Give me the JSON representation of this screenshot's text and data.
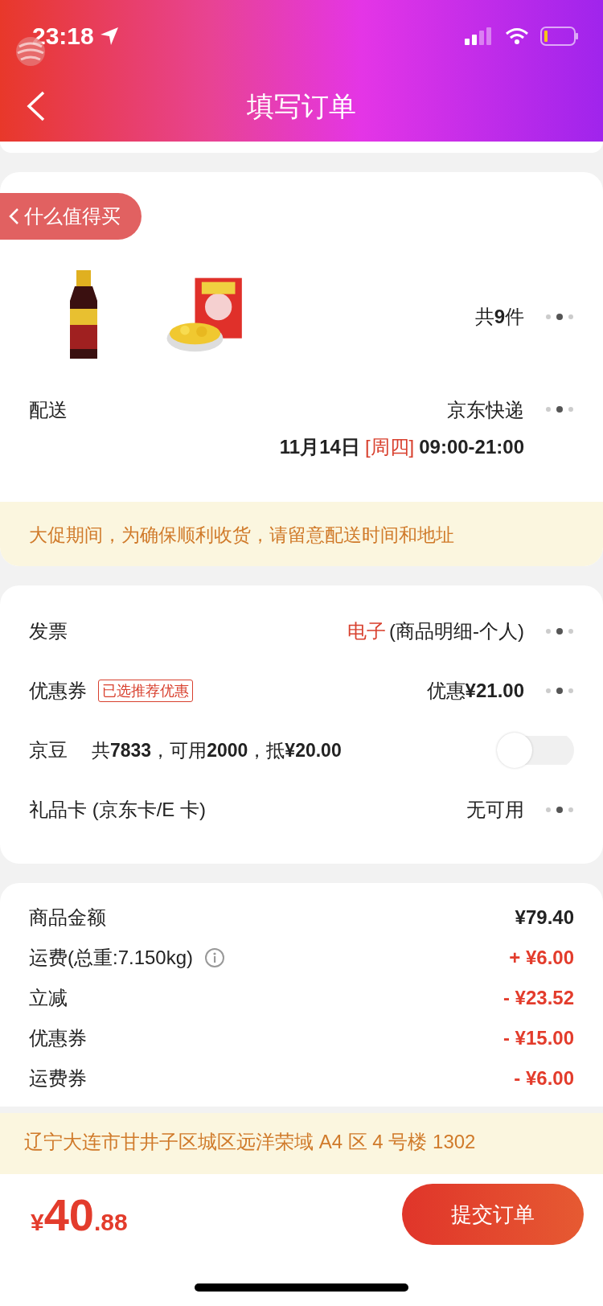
{
  "status_bar": {
    "time": "23:18"
  },
  "nav": {
    "title": "填写订单"
  },
  "float_badge": {
    "label": "什么值得买"
  },
  "products": {
    "count": "共**9**件"
  },
  "delivery": {
    "label": "配送",
    "carrier": "京东快递",
    "date": "11月14日",
    "weekday": "[周四]",
    "time": "09:00-21:00"
  },
  "notice": "大促期间，为确保顺利收货，请留意配送时间和地址",
  "options": [
    {
      "kind": "link",
      "label": "发票",
      "highlight": "电子",
      "value": "(商品明细-个人)"
    },
    {
      "kind": "link",
      "label": "优惠券",
      "tag": "已选推荐优惠",
      "value": "优惠**¥21.00**"
    },
    {
      "kind": "toggle",
      "label": "京豆",
      "detail": "共**7833**，可用**2000**，抵**¥20.00**",
      "on": false
    },
    {
      "kind": "link",
      "label": "礼品卡 (京东卡/E 卡)",
      "value": "无可用"
    }
  ],
  "summary": [
    {
      "label": "商品金额",
      "amount": "¥79.40",
      "highlighted": false,
      "info": false
    },
    {
      "label": "运费(总重:7.150kg)",
      "amount": "+ ¥6.00",
      "highlighted": true,
      "info": true
    },
    {
      "label": "立减",
      "amount": "- ¥23.52",
      "highlighted": true,
      "info": false
    },
    {
      "label": "优惠券",
      "amount": "- ¥15.00",
      "highlighted": true,
      "info": false
    },
    {
      "label": "运费券",
      "amount": "- ¥6.00",
      "highlighted": true,
      "info": false
    }
  ],
  "address": "辽宁大连市甘井子区城区远洋荣域 A4 区 4 号楼 1302",
  "total": {
    "currency": "¥",
    "integer": "40",
    "decimal": ".88"
  },
  "submit": "提交订单"
}
